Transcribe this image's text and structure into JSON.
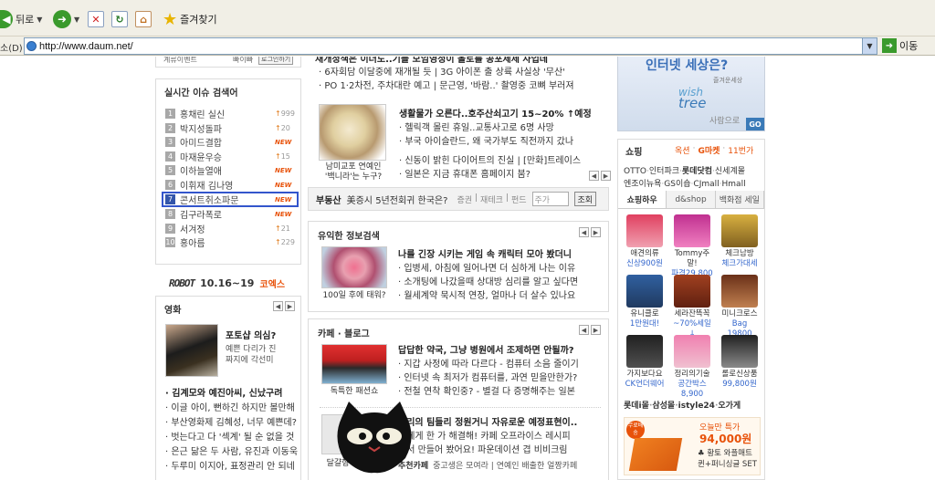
{
  "toolbar": {
    "back_label": "뒤로",
    "favorites_label": "즐겨찾기"
  },
  "address": {
    "label": "소(D)",
    "url": "http://www.daum.net/",
    "go_label": "이동"
  },
  "top_strip": {
    "left_a": "계류이벤트",
    "left_b": "빠이빠",
    "left_button": "로그인하기",
    "headline": "재개정책은 이더도..기들 모임영정이 올토를 공포제제 사업데"
  },
  "realtime": {
    "title": "실시간 이슈 검색어",
    "items": [
      {
        "n": "1",
        "kw": "홍채린 실신",
        "ch": "↑",
        "v": "999"
      },
      {
        "n": "2",
        "kw": "박지성돌파",
        "ch": "↑",
        "v": "20"
      },
      {
        "n": "3",
        "kw": "아미드결합",
        "ch": "NEW",
        "v": ""
      },
      {
        "n": "4",
        "kw": "마재윤우승",
        "ch": "↑",
        "v": "15"
      },
      {
        "n": "5",
        "kw": "이하늘열애",
        "ch": "NEW",
        "v": ""
      },
      {
        "n": "6",
        "kw": "이휘재 김나영",
        "ch": "NEW",
        "v": ""
      },
      {
        "n": "7",
        "kw": "콘서트취소파문",
        "ch": "NEW",
        "v": ""
      },
      {
        "n": "8",
        "kw": "김구라폭로",
        "ch": "NEW",
        "v": ""
      },
      {
        "n": "9",
        "kw": "서겨정",
        "ch": "↑",
        "v": "21"
      },
      {
        "n": "10",
        "kw": "홍아름",
        "ch": "↑",
        "v": "229"
      }
    ]
  },
  "robot": {
    "logo": "ROBOT",
    "dates": "10.16~19",
    "venue": "코엑스"
  },
  "movie": {
    "title": "영화",
    "feature_title": "포토샵 의심?",
    "feature_sub1": "예쁜 다리가 진",
    "feature_sub2": "짜지에 각선미",
    "lines": [
      "김계모와 예진아씨, 신났구려",
      "이글 아이, 뻔하긴 하지만 볼만해",
      "부산영화제 김혜성, 너무 예쁜데?",
      "벗는다고 다 '섹계' 될 순 없을 것",
      "은근 닮은 두 사람, 유진과 이동욱",
      "두루미 이지아, 표정관리 안 되네"
    ]
  },
  "news": {
    "lines_top": [
      "6자회담 이달중에 재개될 듯 | 3G 아이폰 출 상륙 사실상 '무산'",
      "PO 1·2차전, 주차대란 예고 | 문근영, '바람..' 촬영중 코뼈 부러져"
    ],
    "thumb_cap1": "남미교포 연예인",
    "thumb_cap2": "'백니라'는 누구?",
    "bold": "생활물가 오른다..호주산쇠고기 15~20% ↑예정",
    "lines": [
      "헬릭객 몰린 휴일..교통사고로 6명 사망",
      "부국 아이슬란드, 왜 국가부도 직전까지 갔나"
    ],
    "lines2": [
      "신동이 밝힌 다이어트의 진실 | [만화]트레이스",
      "일본은 지금 휴대폰 홈페이지 붐?"
    ],
    "realestate_label": "부동산",
    "realestate_text": "美증시 5년전회귀 한국은?",
    "tabs": [
      "증권",
      "재테크",
      "펀드"
    ],
    "stock_placeholder": "주가",
    "stock_button": "조회"
  },
  "useful": {
    "title": "유익한 정보검색",
    "thumb_cap": "100일 후에 태워?",
    "bold": "나를 긴장 시키는 게임 속 캐릭터 모아 봤더니",
    "lines": [
      "입병세, 아침에 일어나면 더 심하게 나는 이유",
      "소개팅에 나갔을때 상대방 심리를 알고 싶다면",
      "월세계약 묵시적 연장, 얼마나 더 살수 있나요"
    ]
  },
  "cafe": {
    "title": "카페 · 블로그",
    "thumb_cap": "독특한 패션쇼",
    "bold": "답답한 약국, 그냥 병원에서 조제하면 안될까?",
    "lines": [
      "지갑 사정에 따라 다르다 - 컴퓨터 소음 줄이기",
      "인터넷 속 최저가 컴퓨터를, 과연 믿을만한가?",
      "전철 연착 확인중? - 별걸 다 증명해주는 일본"
    ],
    "bold2": "파리의 팀들리 정원거니 자유로운 예정표현이..",
    "lines2": [
      "부에게 한 가 해결해! 카페 오프라이스 레시피",
      "에서 만들어 봤어요! 파운데이션 겹 비비크림"
    ],
    "thumb2_cap": "달걀형 스네이크",
    "recommend_label": "추천카페",
    "recommend_text": "중고생은 모여라 | 연예인 배출한 얼짱카페"
  },
  "ad": {
    "title": "인터넷 세상은?",
    "sub": "즐겨운세상",
    "brand1": "wish",
    "brand2": "tree",
    "slogan": "사람으로",
    "go": "GO"
  },
  "shopping": {
    "title": "쇼핑",
    "links_top": [
      "옥션",
      "G마켓",
      "11번가"
    ],
    "row1": [
      "OTTO",
      "인터파크",
      "롯데닷컴",
      "신세계몰"
    ],
    "row2": [
      "엔조이뉴욕",
      "GS이숍",
      "CJmall",
      "Hmall"
    ],
    "tabs": [
      "쇼핑하우",
      "d&shop",
      "백화점 세일"
    ],
    "products": [
      {
        "name": "애견의류",
        "price": "신상900원"
      },
      {
        "name": "Tommy주말!",
        "price": "파격29,800"
      },
      {
        "name": "체크남방",
        "price": "체크가대세"
      },
      {
        "name": "유니클로",
        "price": "1만원대!"
      },
      {
        "name": "세라잔뜩꼭",
        "price": "~70%세일↓"
      },
      {
        "name": "미니크로스",
        "price": "Bag 19800"
      },
      {
        "name": "가지보다요",
        "price": "CK언더웨어"
      },
      {
        "name": "정리의기술",
        "price": "공간박스8,900"
      },
      {
        "name": "롤로신상품",
        "price": "99,800원"
      }
    ],
    "bottom_links": [
      "롯데i몰",
      "삼성몰",
      "istyle24",
      "오가게"
    ],
    "deal_badge": "무료배송",
    "deal_label": "오늘만 특가",
    "deal_price": "94,000원",
    "deal_line1": "♣ 황토 와플매트",
    "deal_line2": "퀸+퍼니싱글 SET"
  },
  "colors": {
    "accent": "#e8520a",
    "link": "#3366cc",
    "highlight_border": "#3355cc"
  }
}
